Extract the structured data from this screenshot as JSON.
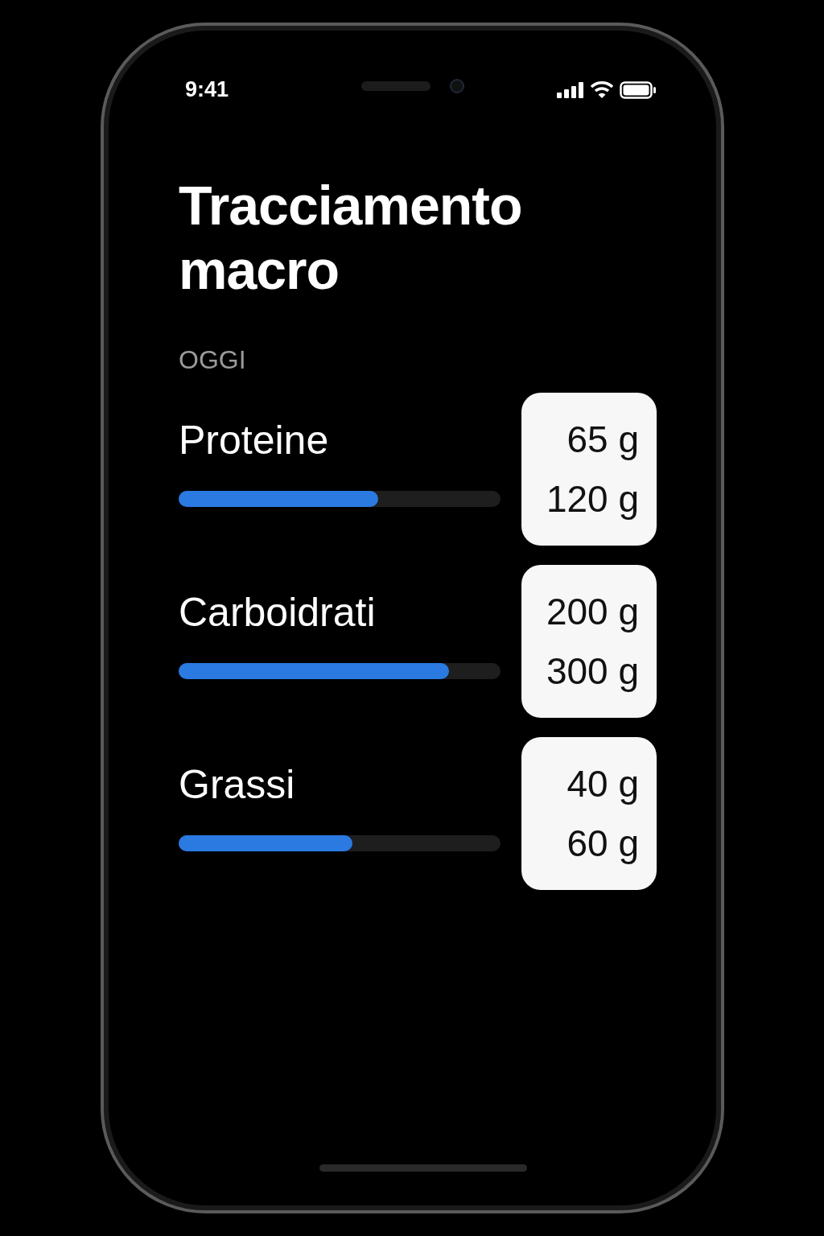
{
  "status_bar": {
    "time": "9:41"
  },
  "title": "Tracciamento macro",
  "section": "OGGI",
  "macros": [
    {
      "name": "Proteine",
      "level": 0.62,
      "consumed": "65 g",
      "goal": "120 g"
    },
    {
      "name": "Carboidrati",
      "level": 0.84,
      "consumed": "200 g",
      "goal": "300 g"
    },
    {
      "name": "Grassi",
      "level": 0.54,
      "consumed": "40 g",
      "goal": "60 g"
    }
  ]
}
